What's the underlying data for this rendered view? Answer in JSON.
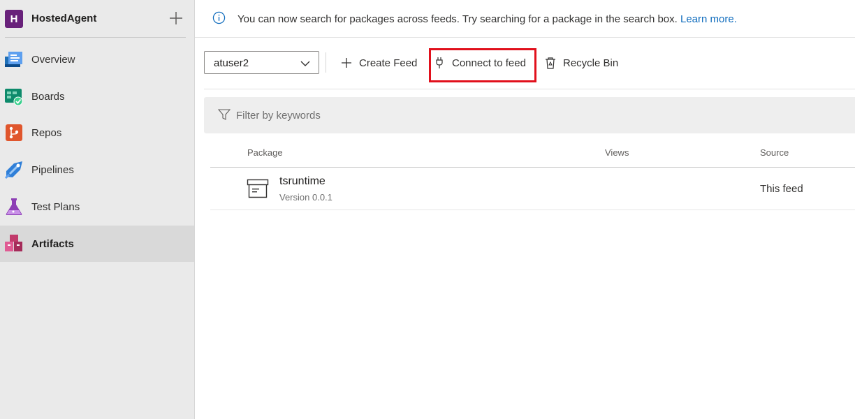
{
  "project": {
    "initial": "H",
    "name": "HostedAgent",
    "add_icon": "plus-icon"
  },
  "nav": {
    "items": [
      {
        "label": "Overview",
        "icon": "overview-icon"
      },
      {
        "label": "Boards",
        "icon": "boards-icon"
      },
      {
        "label": "Repos",
        "icon": "repos-icon"
      },
      {
        "label": "Pipelines",
        "icon": "pipelines-icon"
      },
      {
        "label": "Test Plans",
        "icon": "test-plans-icon"
      },
      {
        "label": "Artifacts",
        "icon": "artifacts-icon",
        "selected": true
      }
    ]
  },
  "banner": {
    "icon": "info-icon",
    "text": "You can now search for packages across feeds. Try searching for a package in the search box.",
    "link": "Learn more."
  },
  "toolbar": {
    "feed_value": "atuser2",
    "create_feed_label": "Create Feed",
    "connect_label": "Connect to feed",
    "recycle_label": "Recycle Bin"
  },
  "filter": {
    "placeholder": "Filter by keywords"
  },
  "table": {
    "columns": [
      "Package",
      "Views",
      "Source"
    ],
    "rows": [
      {
        "name": "tsruntime",
        "version": "Version 0.0.1",
        "views": "",
        "source": "This feed"
      }
    ]
  },
  "colors": {
    "accent_link": "#0f6cbd",
    "highlight": "#e1101c",
    "project_avatar": "#68217a",
    "sidebar_bg": "#eaeaea"
  }
}
